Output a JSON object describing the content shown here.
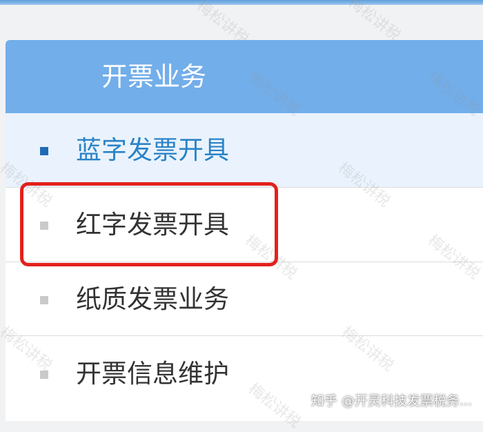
{
  "panel": {
    "title": "开票业务",
    "header_color": "#72aeea"
  },
  "menu": {
    "items": [
      {
        "label": "蓝字发票开具",
        "active": true
      },
      {
        "label": "红字发票开具",
        "active": false,
        "highlighted": true
      },
      {
        "label": "纸质发票业务",
        "active": false
      },
      {
        "label": "开票信息维护",
        "active": false
      }
    ]
  },
  "colors": {
    "active_text": "#2a83c7",
    "active_bullet": "#1f6bb6",
    "highlight_border": "#e3211c"
  },
  "watermark": {
    "text": "梅松讲税"
  },
  "footer": {
    "credit": "知乎 @开灵科技发票税务..."
  }
}
